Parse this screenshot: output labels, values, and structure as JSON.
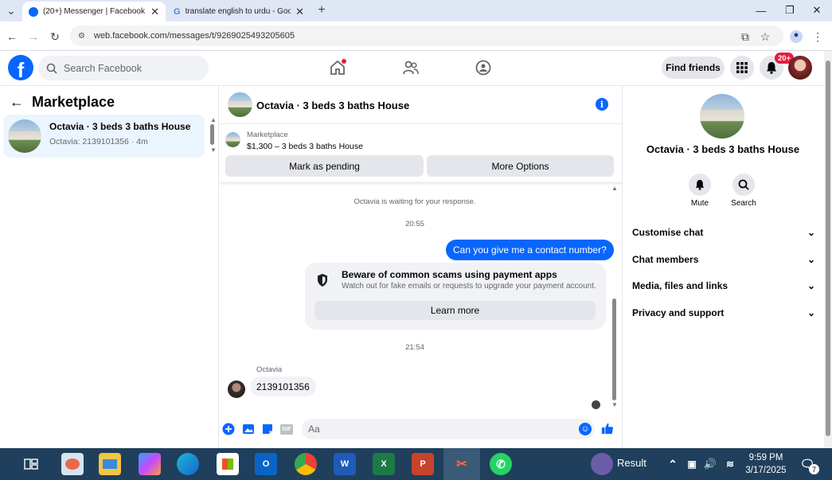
{
  "browser": {
    "tabs": [
      {
        "title": "(20+) Messenger | Facebook",
        "active": true
      },
      {
        "title": "translate english to urdu - Goo",
        "active": false
      }
    ],
    "url": "web.facebook.com/messages/t/9269025493205605"
  },
  "facebook": {
    "logo": "f",
    "search_placeholder": "Search Facebook",
    "find_friends": "Find friends",
    "notif_badge": "20+",
    "brand_color": "#0866ff"
  },
  "left": {
    "title": "Marketplace",
    "conversation": {
      "name": "Octavia · 3 beds 3 baths House",
      "subtitle": "Octavia: 2139101356 · 4m"
    }
  },
  "chat": {
    "header_name": "Octavia · 3 beds 3 baths House",
    "marketplace_label": "Marketplace",
    "listing": "$1,300 – 3 beds 3 baths House",
    "mark_pending": "Mark as pending",
    "more_options": "More Options",
    "waiting_note": "Octavia is waiting for your response.",
    "time1": "20:55",
    "outgoing_message": "Can you give me a contact number?",
    "scam_title": "Beware of common scams using payment apps",
    "scam_subtitle": "Watch out for fake emails or requests to upgrade your payment account.",
    "learn_more": "Learn more",
    "time2": "21:54",
    "sender": "Octavia",
    "incoming_message": "2139101356",
    "input_placeholder": "Aa"
  },
  "right": {
    "name": "Octavia · 3 beds 3 baths House",
    "mute": "Mute",
    "search": "Search",
    "sections": [
      "Customise chat",
      "Chat members",
      "Media, files and links",
      "Privacy and support"
    ]
  },
  "taskbar": {
    "result": "Result",
    "time": "9:59 PM",
    "date": "3/17/2025",
    "notif_count": "7"
  }
}
